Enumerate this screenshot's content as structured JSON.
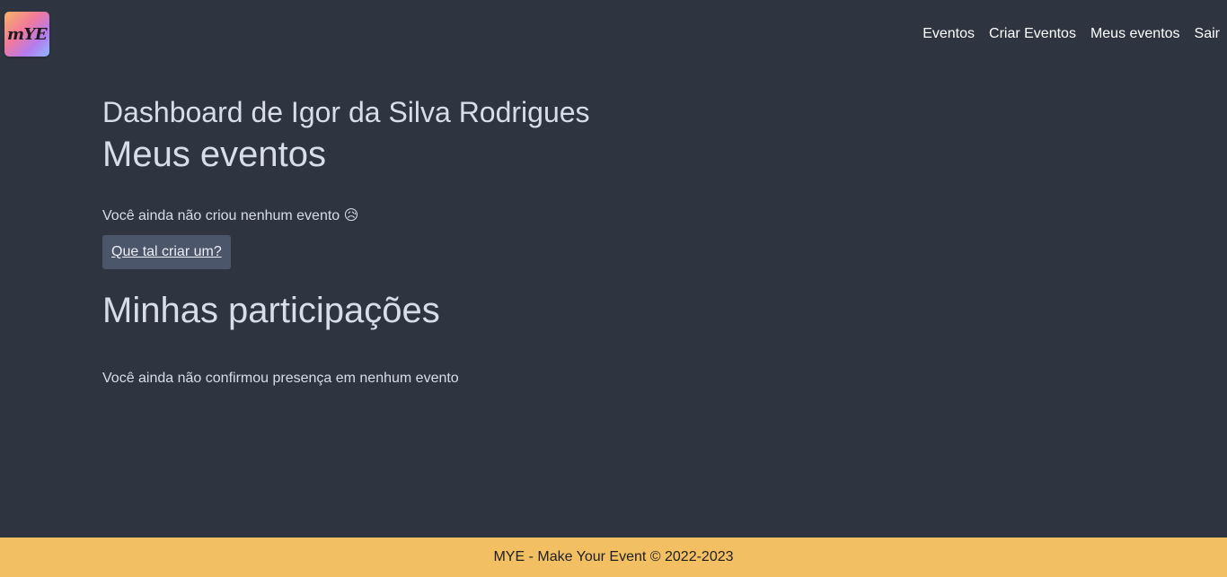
{
  "header": {
    "logo_text": "mYE",
    "nav": [
      {
        "label": "Eventos"
      },
      {
        "label": "Criar Eventos"
      },
      {
        "label": "Meus eventos"
      },
      {
        "label": "Sair"
      }
    ]
  },
  "main": {
    "dashboard_title": "Dashboard de Igor da Silva Rodrigues",
    "my_events": {
      "heading": "Meus eventos",
      "empty_message": "Você ainda não criou nenhum evento 😥",
      "cta_label": "Que tal criar um?"
    },
    "participations": {
      "heading": "Minhas participações",
      "empty_message": "Você ainda não confirmou presença em nenhum evento"
    }
  },
  "footer": {
    "text": "MYE - Make Your Event © 2022-2023"
  },
  "colors": {
    "background": "#2e3440",
    "text": "#d8dee9",
    "button_bg": "#4c566a",
    "footer_bg": "#f2c063"
  }
}
